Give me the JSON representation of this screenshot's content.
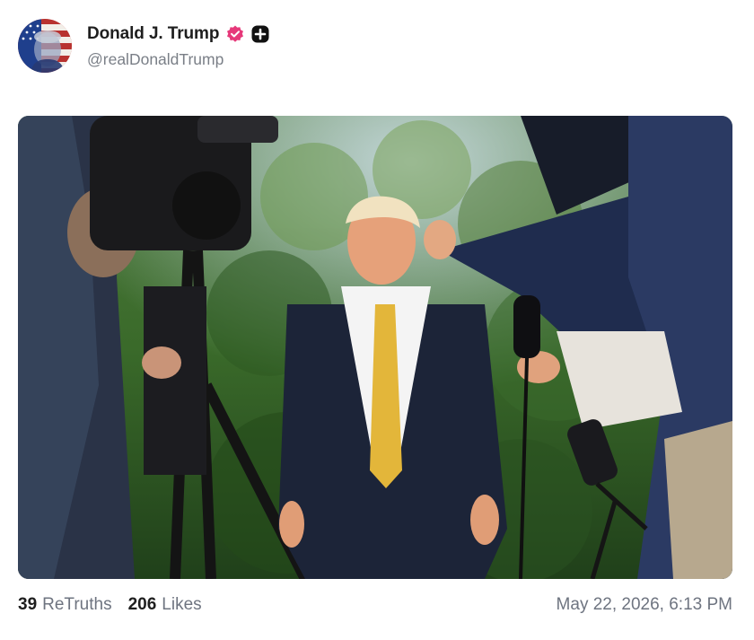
{
  "post": {
    "author": {
      "display_name": "Donald J. Trump",
      "handle": "@realDonaldTrump",
      "avatar_icon": "flag-portrait-avatar",
      "verified_badge_color": "#e6397a",
      "badge_icons": [
        "verified-badge-icon",
        "plus-badge-icon"
      ]
    },
    "media": {
      "type": "photo",
      "content": "photo"
    },
    "stats": {
      "retruths_count": "39",
      "retruths_label": "ReTruths",
      "likes_count": "206",
      "likes_label": "Likes"
    },
    "timestamp": "May 22, 2026, 6:13 PM"
  },
  "colors": {
    "text_primary": "#1e1e1e",
    "text_secondary": "#6e7480",
    "accent_pink": "#e6397a"
  }
}
